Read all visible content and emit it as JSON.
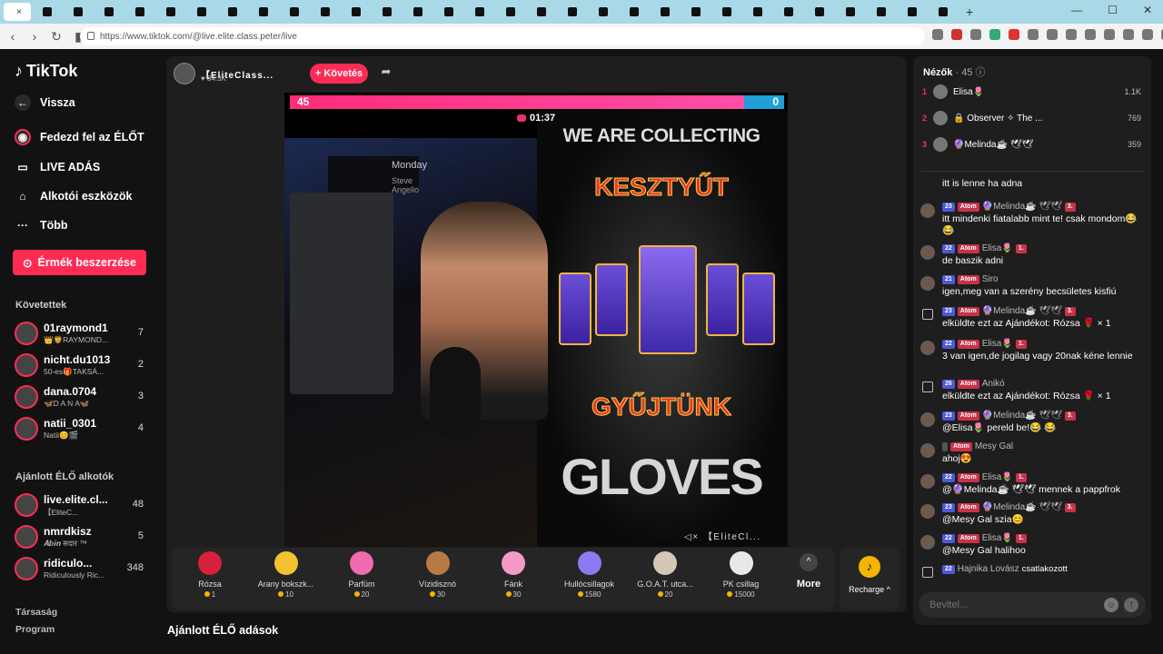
{
  "browser": {
    "url": "https://www.tiktok.com/@live.elite.class.peter/live",
    "tab_close": "×",
    "new_tab": "+"
  },
  "sidebar": {
    "logo": "TikTok",
    "back": "Vissza",
    "nav": [
      {
        "label": "Fedezd fel az ÉLŐT",
        "icon": "live-explore-icon"
      },
      {
        "label": "LIVE ADÁS",
        "icon": "camera-icon"
      },
      {
        "label": "Alkotói eszközök",
        "icon": "house-icon"
      },
      {
        "label": "Több",
        "icon": "more-dots-icon"
      }
    ],
    "coins_button": "Érmék beszerzése",
    "following_title": "Követettek",
    "following": [
      {
        "name": "01raymond1",
        "sub": "👑🦁RAYMOND...",
        "count": "7"
      },
      {
        "name": "nicht.du1013",
        "sub": "50-es🎁TAKSÁ...",
        "count": "2"
      },
      {
        "name": "dana.0704",
        "sub": "🦋D A N A🦋",
        "count": "3"
      },
      {
        "name": "natii_0301",
        "sub": "Natii😊🎬",
        "count": "4"
      }
    ],
    "recommended_title": "Ajánlott ÉLŐ alkotók",
    "recommended": [
      {
        "name": "live.elite.cl...",
        "sub": "【EliteC...",
        "count": "48"
      },
      {
        "name": "nmrdkisz",
        "sub": "𝑨𝒃𝒊𝒏 सदार ™",
        "count": "5"
      },
      {
        "name": "ridiculo...",
        "sub": "Ridiculously Ric...",
        "count": "348"
      }
    ],
    "footer": [
      "Társaság",
      "Program"
    ]
  },
  "stream": {
    "host_name": "【EliteClass...",
    "host_likes": "84.3K",
    "follow": "+ Követés",
    "pk_left": "45",
    "pk_right": "0",
    "timer": "01:37",
    "overlay_title": "Monday",
    "overlay_sub": "Steve Angello",
    "text_line1": "WE ARE COLLECTING",
    "text_line2": "KESZTYŰT",
    "text_line3": "GYŰJTÜNK",
    "text_line4": "GLOVES",
    "watermark": "【EliteCl..."
  },
  "gifts": [
    {
      "name": "Rózsa",
      "price": "1",
      "color": "#d8203a"
    },
    {
      "name": "Arany bokszk...",
      "price": "10",
      "color": "#f2c230"
    },
    {
      "name": "Parfüm",
      "price": "20",
      "color": "#f06ab0"
    },
    {
      "name": "Vízidisznó",
      "price": "30",
      "color": "#b87a45"
    },
    {
      "name": "Fánk",
      "price": "30",
      "color": "#f59ac6"
    },
    {
      "name": "Hullócsillagok",
      "price": "1580",
      "color": "#8a7cf0"
    },
    {
      "name": "G.O.A.T. utca...",
      "price": "20",
      "color": "#d6c6b6"
    },
    {
      "name": "PK csillag",
      "price": "15000",
      "color": "#e8e8e8"
    }
  ],
  "gift_more": "More",
  "recharge": "Recharge",
  "suggested_title": "Ajánlott ÉLŐ adások",
  "viewers": {
    "title": "Nézők",
    "count": "· 45",
    "list": [
      {
        "rank": "1",
        "name": "Elisa🌷",
        "score": "1.1K"
      },
      {
        "rank": "2",
        "name": "🔒 Observer ✧ The ...",
        "score": "769"
      },
      {
        "rank": "3",
        "name": "🔮Melinda☕ 🕊🕊",
        "score": "359"
      }
    ]
  },
  "chat": [
    {
      "type": "partial",
      "text": "itt is lenne ha adna"
    },
    {
      "level": "23",
      "badge": "Atom",
      "user": "🔮Melinda☕ 🕊🕊",
      "rank": "3.",
      "text": "itt mindenki fiatalabb mint te! csak mondom😂 😂"
    },
    {
      "level": "22",
      "badge": "Atom",
      "user": "Elisa🌷",
      "rank": "1.",
      "text": "de baszik adni"
    },
    {
      "level": "21",
      "badge": "Atom",
      "user": "Siro",
      "text": "igen,meg van a szerény becsületes kisfiú"
    },
    {
      "type": "gift",
      "level": "23",
      "badge": "Atom",
      "user": "🔮Melinda☕ 🕊🕊",
      "rank": "3.",
      "text": "elküldte ezt az Ajándékot: Rózsa 🌹 × 1"
    },
    {
      "level": "22",
      "badge": "Atom",
      "user": "Elisa🌷",
      "rank": "1.",
      "text": "3 van igen,de jogilag vagy 20nak kéne lennie"
    },
    {
      "type": "gift",
      "level": "26",
      "badge": "Atom",
      "user": "Anikó",
      "text": "elküldte ezt az Ajándékot: Rózsa 🌹 × 1"
    },
    {
      "level": "23",
      "badge": "Atom",
      "user": "🔮Melinda☕ 🕊🕊",
      "rank": "3.",
      "text": "@Elisa🌷 pereld be!😂 😂"
    },
    {
      "level": "",
      "badge": "Atom",
      "user": "Mesy Gal",
      "text": "ahoj😍"
    },
    {
      "level": "22",
      "badge": "Atom",
      "user": "Elisa🌷",
      "rank": "1.",
      "text": "@🔮Melinda☕ 🕊🕊 mennek a pappfrok"
    },
    {
      "level": "23",
      "badge": "Atom",
      "user": "🔮Melinda☕ 🕊🕊",
      "rank": "3.",
      "text": "@Mesy Gal szia😊"
    },
    {
      "level": "22",
      "badge": "Atom",
      "user": "Elisa🌷",
      "rank": "1.",
      "text": "@Mesy Gal halihoo"
    },
    {
      "type": "join",
      "level": "22",
      "user": "Hajnika Lovász",
      "text": "csatlakozott"
    }
  ],
  "chat_input_placeholder": "Bevitel...",
  "colors": {
    "accent": "#fe2c55",
    "background": "#121212",
    "panel": "#1e1e1e"
  }
}
